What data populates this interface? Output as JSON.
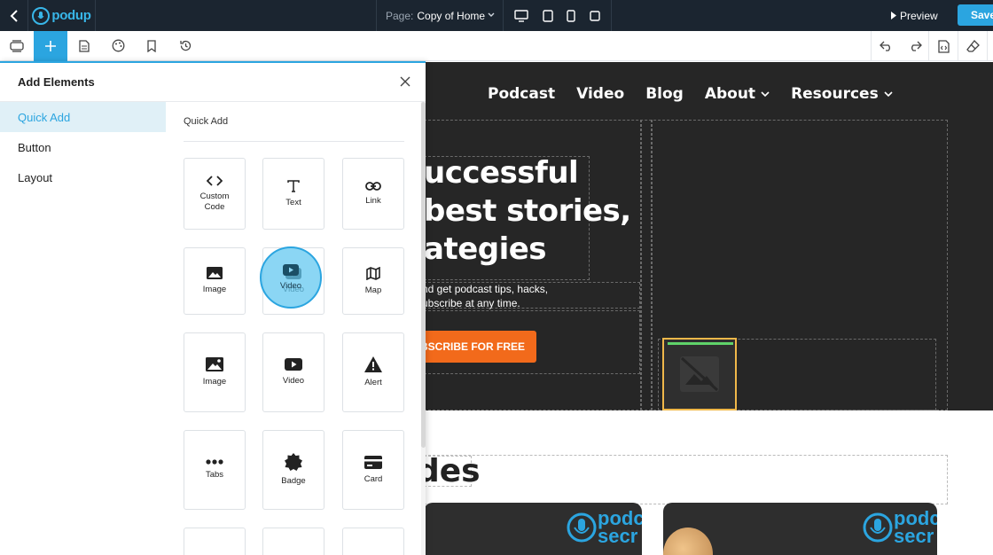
{
  "topbar": {
    "logo_text": "podup",
    "page_label": "Page:",
    "page_value": "Copy of Home",
    "preview_label": "Preview",
    "save_label": "Save"
  },
  "canvas": {
    "nav": [
      "Podcast",
      "Video",
      "Blog",
      "About",
      "Resources"
    ],
    "hero_lines": [
      "uccessful",
      "best stories,",
      "ategies"
    ],
    "hero_sub_lines": [
      "nd get podcast tips, hacks,",
      "ubscribe at any time."
    ],
    "cta_label": "BSCRIBE FOR FREE",
    "section_title": "des",
    "card_logo_text": "podc\nsecr"
  },
  "panel": {
    "title": "Add Elements",
    "side_nav": [
      "Quick Add",
      "Button",
      "Layout"
    ],
    "content_heading": "Quick Add",
    "tiles": [
      {
        "label": "Custom Code",
        "icon": "code-icon"
      },
      {
        "label": "Text",
        "icon": "text-icon"
      },
      {
        "label": "Link",
        "icon": "link-icon"
      },
      {
        "label": "Image",
        "icon": "image-icon"
      },
      {
        "label": "Video",
        "icon": "video-icon"
      },
      {
        "label": "Map",
        "icon": "map-icon"
      },
      {
        "label": "Image",
        "icon": "image-icon"
      },
      {
        "label": "Video",
        "icon": "video-icon"
      },
      {
        "label": "Alert",
        "icon": "alert-icon"
      },
      {
        "label": "Tabs",
        "icon": "tabs-icon"
      },
      {
        "label": "Badge",
        "icon": "badge-icon"
      },
      {
        "label": "Card",
        "icon": "card-icon"
      }
    ]
  },
  "colors": {
    "accent": "#2ba5e0",
    "topbar": "#1b2530",
    "cta": "#f26a1b",
    "canvas_dark": "#262626"
  }
}
